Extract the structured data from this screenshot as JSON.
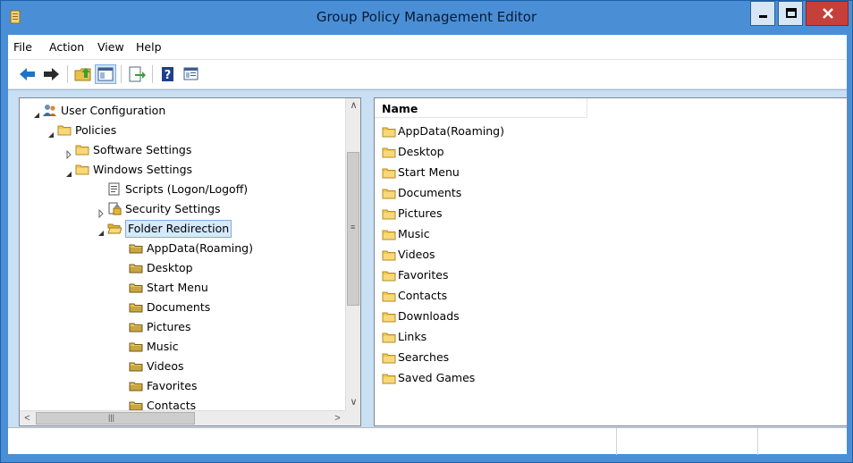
{
  "window": {
    "title": "Group Policy Management Editor"
  },
  "menu": {
    "items": [
      "File",
      "Action",
      "View",
      "Help"
    ]
  },
  "toolbar": {
    "buttons": [
      "back-icon",
      "forward-icon",
      "up-folder-icon",
      "show-hide-tree-icon",
      "export-list-icon",
      "help-icon",
      "properties-icon"
    ]
  },
  "tree": {
    "items": [
      {
        "label": "User Configuration",
        "icon": "user-config-icon",
        "level": 0,
        "expander": "expanded"
      },
      {
        "label": "Policies",
        "icon": "folder-icon",
        "level": 1,
        "expander": "expanded"
      },
      {
        "label": "Software Settings",
        "icon": "folder-icon",
        "level": 2,
        "expander": "collapsed"
      },
      {
        "label": "Windows Settings",
        "icon": "folder-icon",
        "level": 2,
        "expander": "expanded"
      },
      {
        "label": "Scripts (Logon/Logoff)",
        "icon": "scripts-icon",
        "level": 3,
        "expander": "none"
      },
      {
        "label": "Security Settings",
        "icon": "security-icon",
        "level": 3,
        "expander": "collapsed"
      },
      {
        "label": "Folder Redirection",
        "icon": "open-folder-icon",
        "level": 3,
        "expander": "expanded",
        "selected": true
      },
      {
        "label": "AppData(Roaming)",
        "icon": "redirect-folder-icon",
        "level": 4,
        "expander": "none"
      },
      {
        "label": "Desktop",
        "icon": "redirect-folder-icon",
        "level": 4,
        "expander": "none"
      },
      {
        "label": "Start Menu",
        "icon": "redirect-folder-icon",
        "level": 4,
        "expander": "none"
      },
      {
        "label": "Documents",
        "icon": "redirect-folder-icon",
        "level": 4,
        "expander": "none"
      },
      {
        "label": "Pictures",
        "icon": "redirect-folder-icon",
        "level": 4,
        "expander": "none"
      },
      {
        "label": "Music",
        "icon": "redirect-folder-icon",
        "level": 4,
        "expander": "none"
      },
      {
        "label": "Videos",
        "icon": "redirect-folder-icon",
        "level": 4,
        "expander": "none"
      },
      {
        "label": "Favorites",
        "icon": "redirect-folder-icon",
        "level": 4,
        "expander": "none"
      },
      {
        "label": "Contacts",
        "icon": "redirect-folder-icon",
        "level": 4,
        "expander": "none"
      }
    ]
  },
  "list": {
    "column_header": "Name",
    "items": [
      "AppData(Roaming)",
      "Desktop",
      "Start Menu",
      "Documents",
      "Pictures",
      "Music",
      "Videos",
      "Favorites",
      "Contacts",
      "Downloads",
      "Links",
      "Searches",
      "Saved Games"
    ]
  },
  "colors": {
    "window_frame": "#4a8fd6",
    "close_button": "#c6403b",
    "selection": "#d6e8fa",
    "pane_background": "#c9dff3"
  }
}
